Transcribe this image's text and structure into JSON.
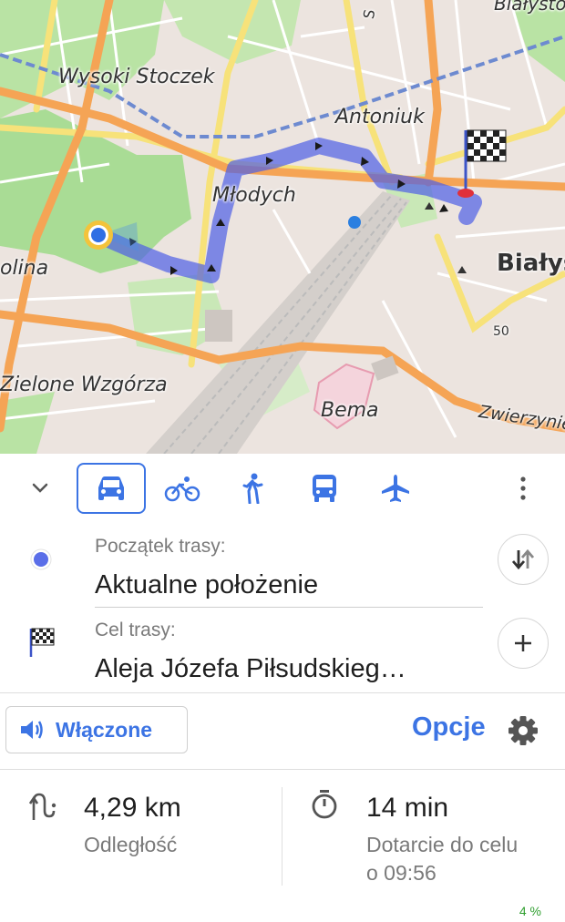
{
  "map": {
    "labels": {
      "bialystok_top": "Białysto",
      "wysoki_stoczek": "Wysoki Stoczek",
      "antoniuk": "Antoniuk",
      "mlodych": "Młodych",
      "bialys": "Białys",
      "olina": "olina",
      "zielone_wzgorza": "Zielone Wzgórza",
      "bema": "Bema",
      "zwierzyniec": "Zwierzynie",
      "road_s": "S",
      "road_50": "50"
    }
  },
  "transport_modes": [
    {
      "name": "car",
      "icon": "car-icon",
      "selected": true
    },
    {
      "name": "bicycle",
      "icon": "bicycle-icon",
      "selected": false
    },
    {
      "name": "pedestrian",
      "icon": "pedestrian-icon",
      "selected": false
    },
    {
      "name": "public-transport",
      "icon": "bus-icon",
      "selected": false
    },
    {
      "name": "aircraft",
      "icon": "airplane-icon",
      "selected": false
    }
  ],
  "route": {
    "start": {
      "caption": "Początek trasy:",
      "value": "Aktualne położenie"
    },
    "destination": {
      "caption": "Cel trasy:",
      "value": "Aleja Józefa Piłsudskieg…"
    }
  },
  "voice": {
    "label": "Włączone",
    "icon": "speaker-icon"
  },
  "options": {
    "label": "Opcje"
  },
  "stats": {
    "distance": {
      "value": "4,29 km",
      "label": "Odległość"
    },
    "time": {
      "value": "14 min",
      "label_line1": "Dotarcie do celu",
      "label_line2": "o 09:56"
    }
  },
  "status": {
    "percent": "4 %"
  },
  "colors": {
    "accent": "#3c74e4",
    "route": "#4f60e6",
    "park": "#b9e3a4",
    "road_major": "#f5a455",
    "road_yellow": "#f7e27a"
  }
}
